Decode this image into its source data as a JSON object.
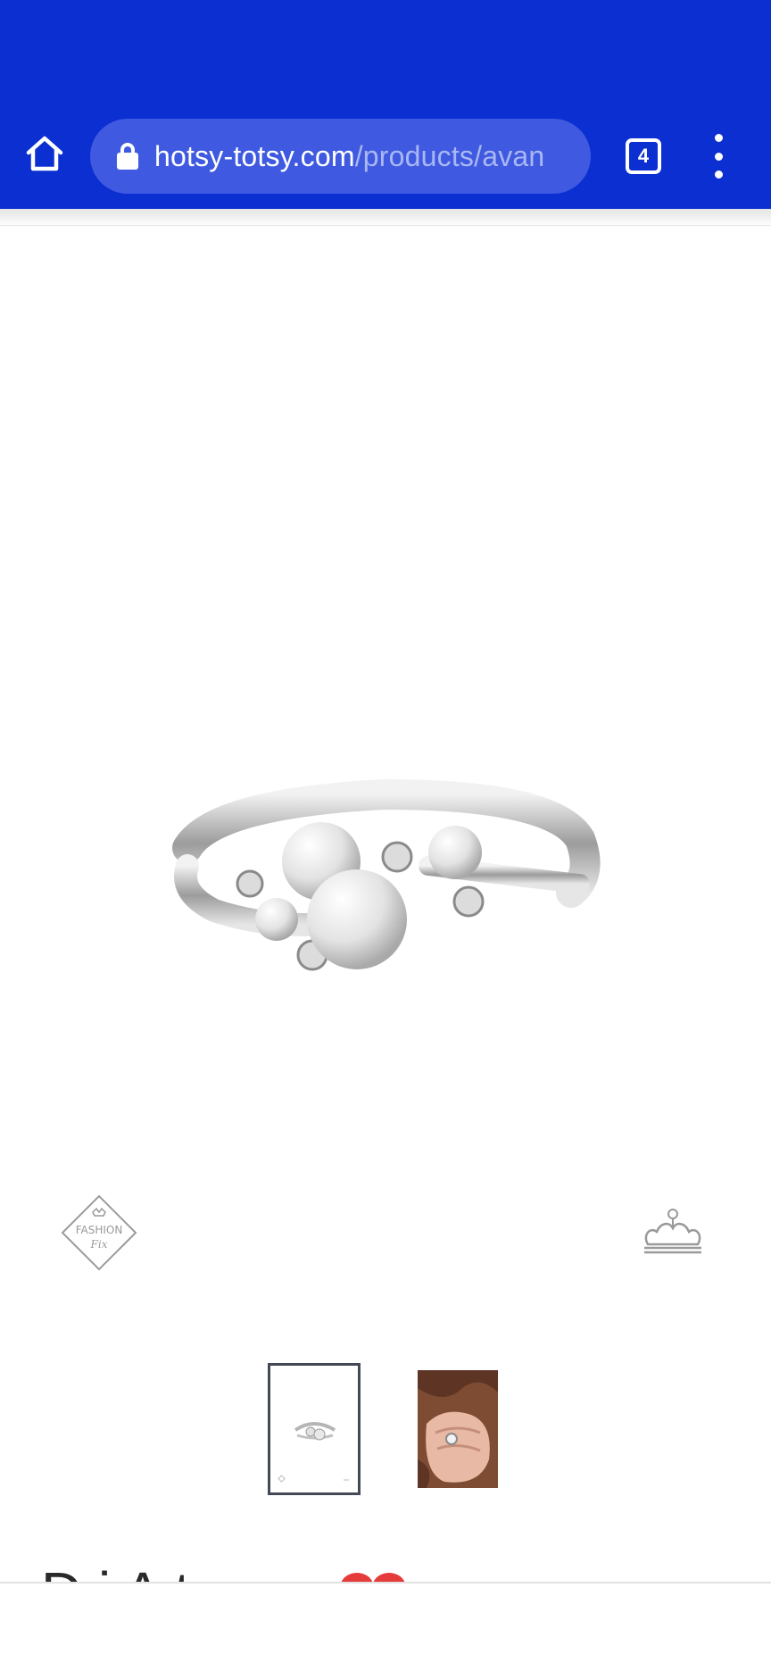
{
  "browser": {
    "url_domain": "hotsy-totsy.com",
    "url_path": "/products/avan",
    "tab_count": "4",
    "accent_color": "#0b2fd0"
  },
  "icons": {
    "home": "home-icon",
    "lock": "lock-icon",
    "tabs": "tab-switcher-icon",
    "menu": "more-vert-icon",
    "fashion_fix": "fashion-fix-badge",
    "crown": "crown-badge",
    "heart": "heart-icon"
  },
  "product": {
    "badge_text_1": "FASHION",
    "badge_text_2": "Fix",
    "thumbnails": [
      "ring-product-thumbnail",
      "ring-on-hand-thumbnail"
    ],
    "selected_thumbnail": 1,
    "title_partial": "D          i        A          t"
  }
}
